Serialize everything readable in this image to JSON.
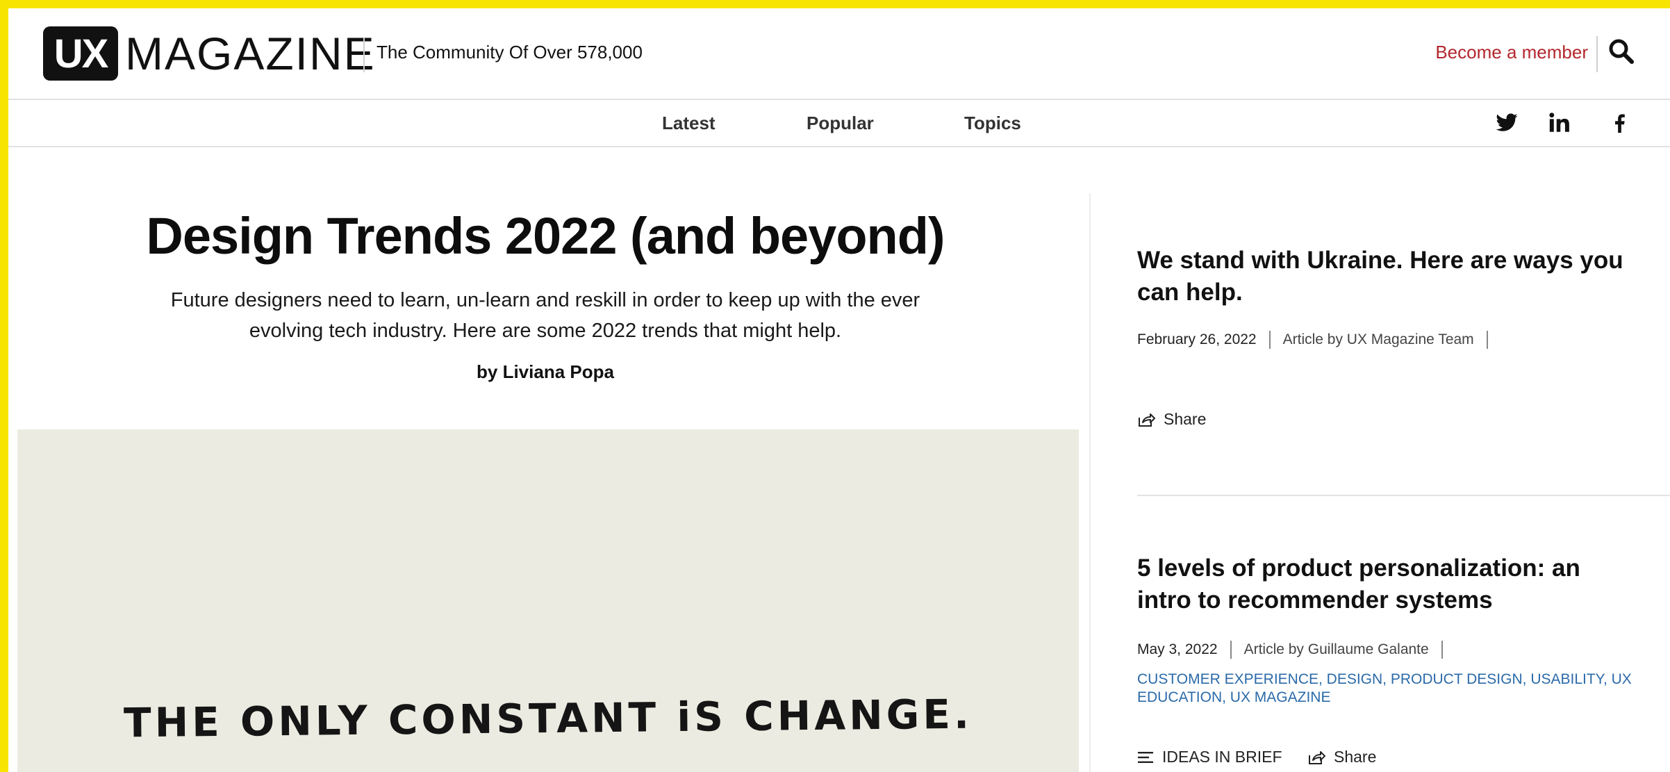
{
  "header": {
    "logo_ux": "UX",
    "logo_magazine": "MAGAZINE",
    "tagline": "The Community Of Over 578,000",
    "member_link": "Become a member"
  },
  "nav": {
    "items": [
      "Latest",
      "Popular",
      "Topics"
    ]
  },
  "social": [
    "twitter-icon",
    "linkedin-icon",
    "facebook-icon"
  ],
  "article": {
    "title": "Design Trends 2022 (and beyond)",
    "subtitle": "Future designers need to learn, un-learn and reskill in order to keep up with the ever evolving tech industry. Here are some 2022 trends that might help.",
    "byline": "by Liviana Popa",
    "hero_text": "THE ONLY CONSTANT iS CHANGE."
  },
  "sidebar": {
    "cards": [
      {
        "title": "We stand with Ukraine. Here are ways you can help.",
        "date": "February 26, 2022",
        "author": "Article by UX Magazine Team",
        "tags": "",
        "share_label": "Share"
      },
      {
        "title": "5 levels of product personalization: an intro to recommender systems",
        "date": "May 3, 2022",
        "author": "Article by Guillaume Galante",
        "tags": "CUSTOMER EXPERIENCE, DESIGN, PRODUCT DESIGN, USABILITY, UX EDUCATION, UX MAGAZINE",
        "category_label": "IDEAS IN BRIEF",
        "share_label": "Share"
      }
    ]
  },
  "colors": {
    "frame": "#f7e400",
    "accent_red": "#b3272d",
    "tag_blue": "#2b6aa8",
    "hero_bg": "#ecebe1"
  }
}
